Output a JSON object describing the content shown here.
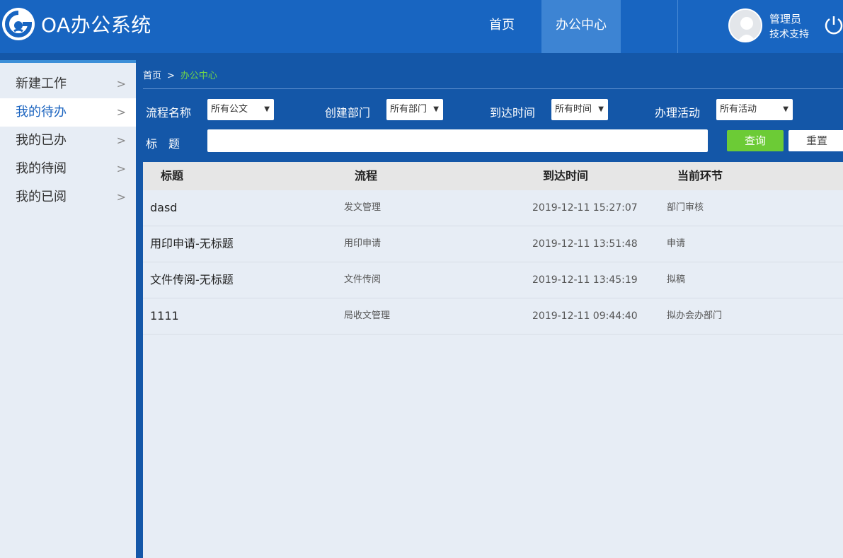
{
  "header": {
    "app_title": "OA办公系统",
    "nav": [
      "首页",
      "办公中心"
    ],
    "user_name": "管理员",
    "user_role": "技术支持"
  },
  "sidebar": {
    "items": [
      {
        "label": "新建工作"
      },
      {
        "label": "我的待办"
      },
      {
        "label": "我的已办"
      },
      {
        "label": "我的待阅"
      },
      {
        "label": "我的已阅"
      }
    ],
    "chevron": ">"
  },
  "breadcrumb": {
    "home": "首页",
    "separator": ">",
    "current": "办公中心"
  },
  "filters": {
    "flow_label": "流程名称",
    "flow_value": "所有公文",
    "dept_label": "创建部门",
    "dept_value": "所有部门",
    "time_label": "到达时间",
    "time_value": "所有时间",
    "activity_label": "办理活动",
    "activity_value": "所有活动",
    "title_label": "标　题",
    "title_value": "",
    "query_button": "查询",
    "reset_button": "重置"
  },
  "table": {
    "columns": [
      "标题",
      "流程",
      "到达时间",
      "当前环节"
    ],
    "rows": [
      {
        "title": "dasd",
        "flow": "发文管理",
        "time": "2019-12-11 15:27:07",
        "step": "部门审核"
      },
      {
        "title": "用印申请-无标题",
        "flow": "用印申请",
        "time": "2019-12-11 13:51:48",
        "step": "申请"
      },
      {
        "title": "文件传阅-无标题",
        "flow": "文件传阅",
        "time": "2019-12-11 13:45:19",
        "step": "拟稿"
      },
      {
        "title": "1111",
        "flow": "局收文管理",
        "time": "2019-12-11 09:44:40",
        "step": "拟办会办部门"
      }
    ]
  },
  "colors": {
    "header_bg": "#1865c1",
    "main_bg": "#1457a8",
    "accent_green": "#6ccb36",
    "active_blue": "#1a63bf"
  }
}
